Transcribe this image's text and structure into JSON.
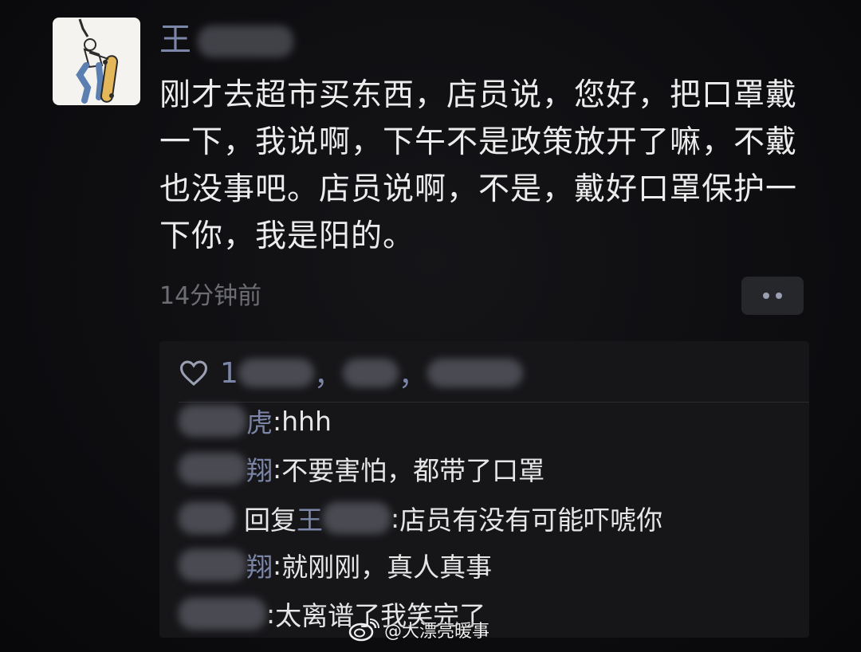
{
  "post": {
    "author_visible": "王",
    "text": "刚才去超市买东西，店员说，您好，把口罩戴一下，我说啊，下午不是政策放开了嘛，不戴也没事吧。店员说啊，不是，戴好口罩保护一下你，我是阳的。",
    "timestamp": "14分钟前"
  },
  "likes": {
    "visible_fragment": "1",
    "separators": [
      "，",
      "，"
    ]
  },
  "comments": [
    {
      "who_suffix": "虎",
      "sep": ": ",
      "text": "hhh"
    },
    {
      "who_suffix": "翔",
      "sep": ": ",
      "text": "不要害怕，都带了口罩"
    },
    {
      "who_suffix": "",
      "reply_word": "回复",
      "reply_to_visible": "王",
      "sep": ": ",
      "text": "店员有没有可能吓唬你"
    },
    {
      "who_suffix": "翔",
      "sep": ": ",
      "text": "就刚刚，真人真事"
    },
    {
      "who_suffix": "",
      "sep": ": ",
      "text": "太离谱了我笑完了"
    }
  ],
  "watermark": {
    "text": "@大漂亮暖事"
  },
  "icons": {
    "like": "heart-outline-icon",
    "more": "more-dots-icon",
    "watermark": "weibo-logo-icon"
  },
  "colors": {
    "background": "#0c0c0f",
    "name_link": "#7b86a8",
    "comment_panel": "#161619",
    "text": "#ececec",
    "timestamp": "#6d6e73"
  }
}
